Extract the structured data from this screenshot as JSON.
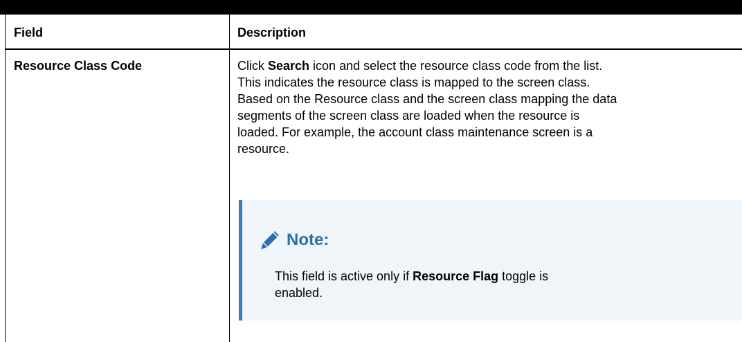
{
  "table": {
    "headers": {
      "field": "Field",
      "description": "Description"
    },
    "rows": [
      {
        "field": "Resource Class Code",
        "description": {
          "line1_pre": "Click ",
          "line1_bold": "Search",
          "line1_post": " icon and select the resource class code from the list.",
          "line2": "This indicates the resource class is mapped to the screen class.",
          "line3": "Based on the Resource class and the screen class mapping the data",
          "line4": "segments of the screen class are loaded when the resource is",
          "line5": "loaded. For example, the account class maintenance screen is a",
          "line6": "resource."
        },
        "note": {
          "icon": "pencil-icon",
          "title": "Note:",
          "text_pre": "This field is active only if ",
          "text_bold": "Resource Flag",
          "text_post": " toggle is",
          "text_line2": "enabled."
        }
      }
    ]
  },
  "colors": {
    "note_bar": "#3e79b8",
    "note_title": "#2f6dad",
    "note_background": "#f0f5fa"
  }
}
